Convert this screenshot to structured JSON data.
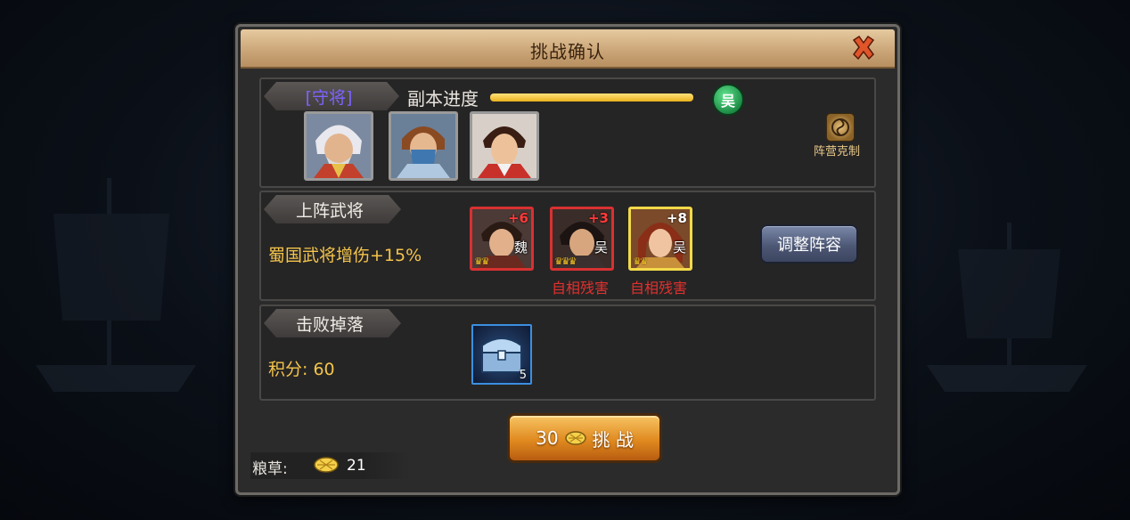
{
  "dialog": {
    "title": "挑战确认"
  },
  "defender": {
    "tag": "[守将]",
    "progress_label": "副本进度",
    "progress_fraction": 1.0,
    "faction_badge": "吴",
    "portraits": [
      "guard-general-1",
      "guard-general-2",
      "guard-general-3"
    ],
    "counter_label": "阵营克制"
  },
  "lineup": {
    "tag": "上阵武将",
    "buff_text": "蜀国武将增伤+15%",
    "heroes": [
      {
        "plus": "+6",
        "faction": "魏",
        "debuff": ""
      },
      {
        "plus": "+3",
        "faction": "吴",
        "debuff": "自相残害"
      },
      {
        "plus": "+8",
        "faction": "吴",
        "debuff": "自相残害"
      }
    ],
    "adjust_button": "调整阵容"
  },
  "drops": {
    "tag": "击败掉落",
    "score_text": "积分: 60",
    "item_count": "5"
  },
  "challenge": {
    "cost": "30",
    "label": "挑 战"
  },
  "footer": {
    "food_label": "粮草:",
    "food_value": "21"
  },
  "colors": {
    "accent_gold": "#f3c44b",
    "debuff_red": "#e0312e",
    "guard_purple": "#7c63ff"
  }
}
